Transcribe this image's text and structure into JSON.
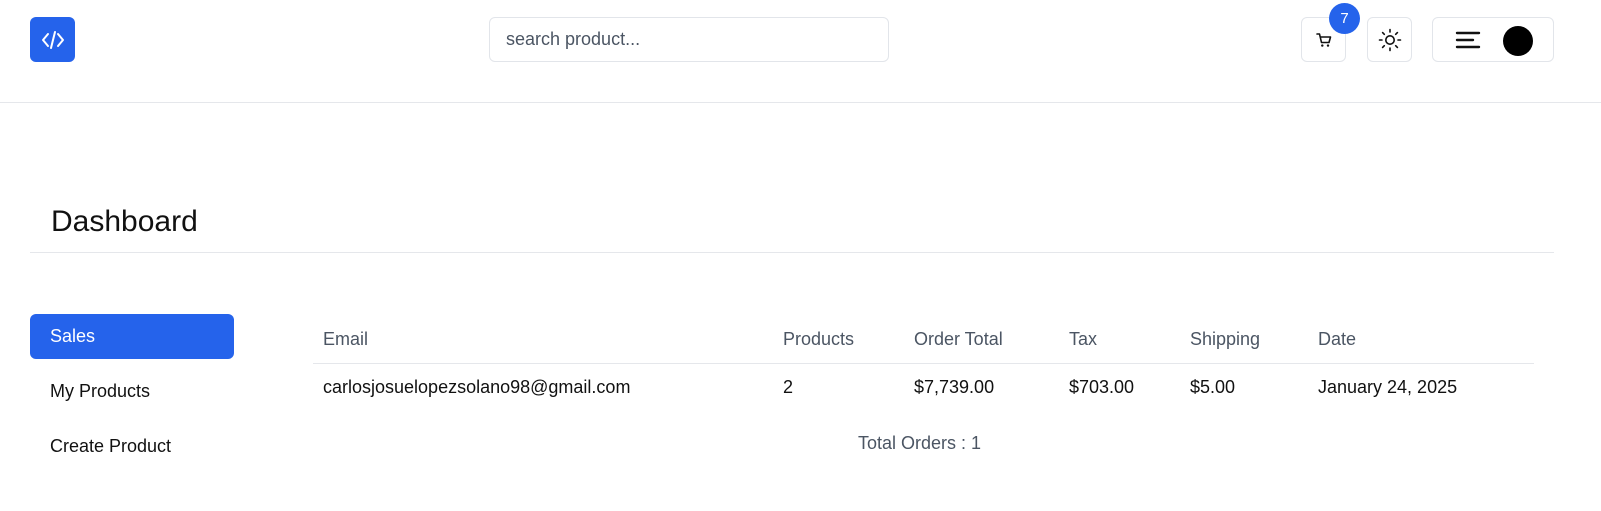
{
  "header": {
    "logo_icon": "code-icon",
    "search": {
      "placeholder": "search product...",
      "value": ""
    },
    "cart": {
      "icon": "cart-icon",
      "count": "7"
    },
    "theme_icon": "sun-icon",
    "menu_icon": "menu-icon",
    "accent_color": "#2563eb"
  },
  "page": {
    "title": "Dashboard"
  },
  "sidebar": {
    "items": [
      {
        "label": "Sales",
        "active": true
      },
      {
        "label": "My Products",
        "active": false
      },
      {
        "label": "Create Product",
        "active": false
      }
    ]
  },
  "orders": {
    "columns": [
      "Email",
      "Products",
      "Order Total",
      "Tax",
      "Shipping",
      "Date"
    ],
    "rows": [
      [
        "carlosjosuelopezsolano98@gmail.com",
        "2",
        "$7,739.00",
        "$703.00",
        "$5.00",
        "January 24, 2025"
      ]
    ],
    "total_label": "Total Orders : ",
    "total_value": "1"
  }
}
